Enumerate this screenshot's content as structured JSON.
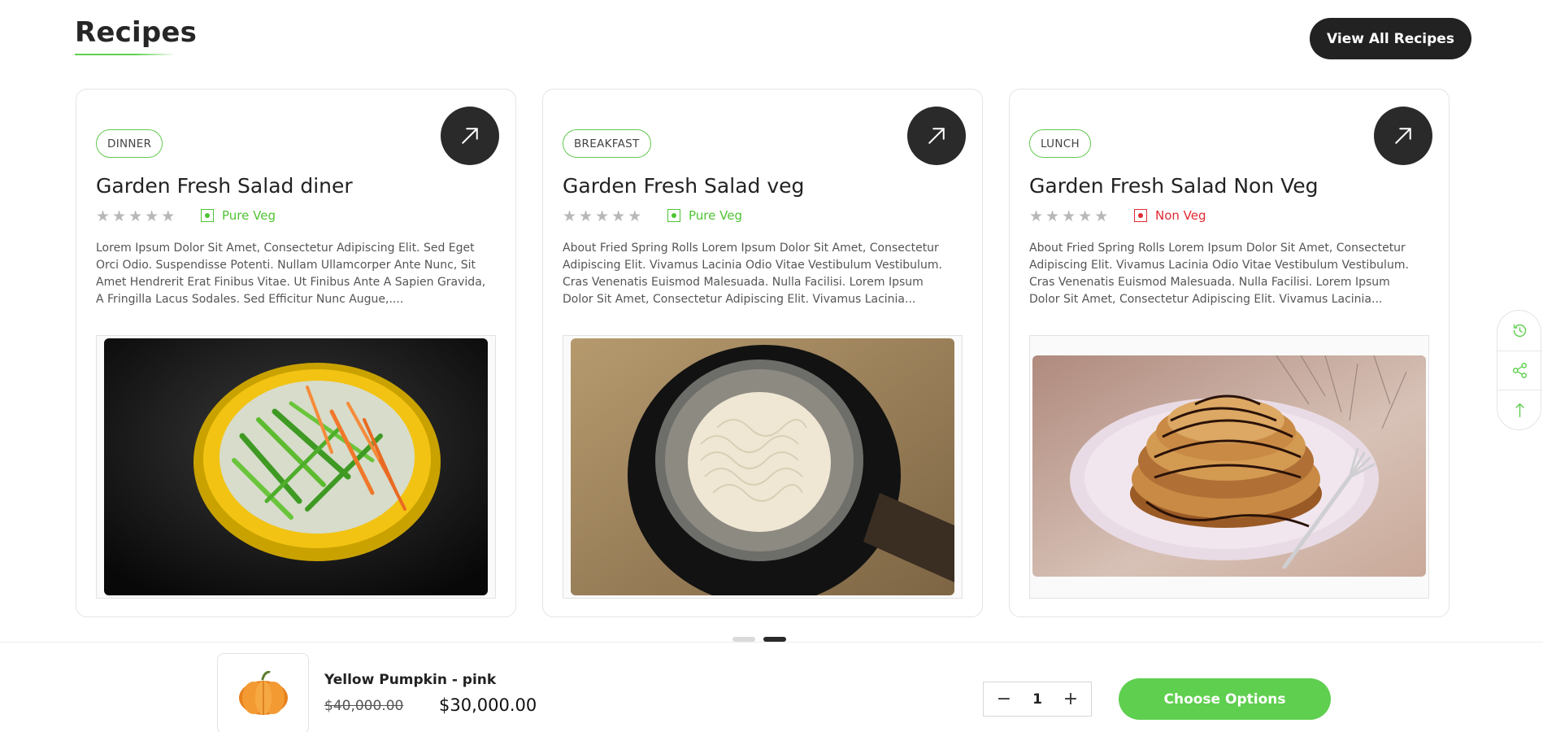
{
  "section": {
    "title": "Recipes",
    "view_all_label": "View All Recipes"
  },
  "recipes": [
    {
      "category": "DINNER",
      "title": "Garden Fresh Salad diner",
      "rating": 0,
      "diet_label": "Pure Veg",
      "diet_type": "veg",
      "description": "Lorem Ipsum Dolor Sit Amet, Consectetur Adipiscing Elit. Sed Eget Orci Odio. Suspendisse Potenti. Nullam Ullamcorper Ante Nunc, Sit Amet Hendrerit Erat Finibus Vitae. Ut Finibus Ante A Sapien Gravida, A Fringilla Lacus Sodales. Sed Efficitur Nunc Augue,...."
    },
    {
      "category": "BREAKFAST",
      "title": "Garden Fresh Salad veg",
      "rating": 0,
      "diet_label": "Pure Veg",
      "diet_type": "veg",
      "description": "About Fried Spring Rolls Lorem Ipsum Dolor Sit Amet, Consectetur Adipiscing Elit. Vivamus Lacinia Odio Vitae Vestibulum Vestibulum. Cras Venenatis Euismod Malesuada. Nulla Facilisi. Lorem Ipsum Dolor Sit Amet, Consectetur Adipiscing Elit. Vivamus Lacinia..."
    },
    {
      "category": "LUNCH",
      "title": "Garden Fresh Salad Non Veg",
      "rating": 0,
      "diet_label": "Non Veg",
      "diet_type": "nonveg",
      "description": "About Fried Spring Rolls Lorem Ipsum Dolor Sit Amet, Consectetur Adipiscing Elit. Vivamus Lacinia Odio Vitae Vestibulum Vestibulum. Cras Venenatis Euismod Malesuada. Nulla Facilisi. Lorem Ipsum Dolor Sit Amet, Consectetur Adipiscing Elit. Vivamus Lacinia..."
    }
  ],
  "pagination": {
    "pages": 2,
    "active": 2
  },
  "side_tools": [
    "history-icon",
    "share-icon",
    "arrow-up-icon"
  ],
  "sticky_cart": {
    "product_name": "Yellow Pumpkin - pink",
    "old_price": "$40,000.00",
    "price": "$30,000.00",
    "quantity": "1",
    "cta_label": "Choose Options"
  },
  "colors": {
    "accent_green": "#5fcf4f",
    "dark": "#222222",
    "nonveg_red": "#e02a33"
  }
}
